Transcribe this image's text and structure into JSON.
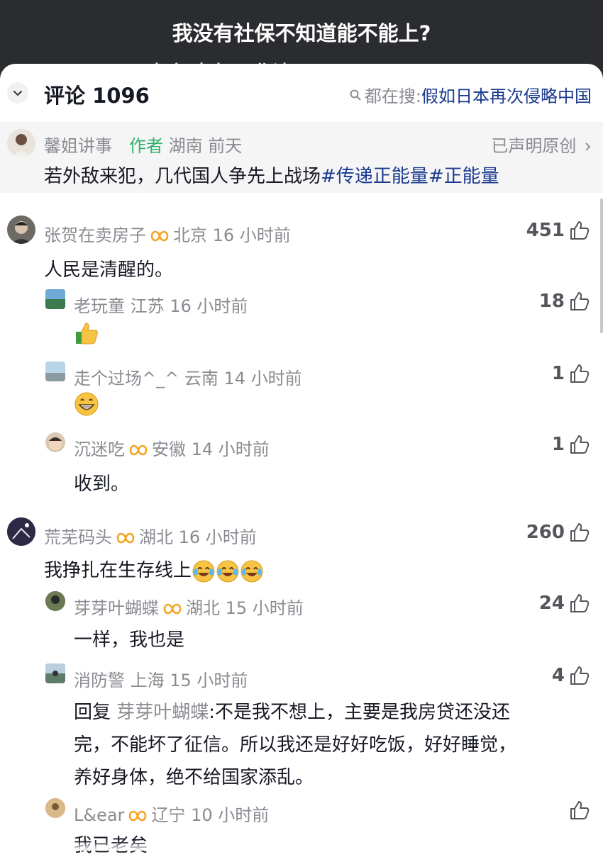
{
  "video": {
    "caption_line1": "我没有社保不知道能不能上?",
    "caption_line2": "有房 大有用              作请?"
  },
  "header": {
    "comment_count": "评论 1096",
    "search_prefix": "都在搜:",
    "search_term": "假如日本再次侵略中国"
  },
  "post": {
    "author": "馨姐讲事",
    "author_tag": "作者",
    "location": "湖南",
    "time": "前天",
    "declared": "已声明原创",
    "text": "若外敌来犯，几代国人争先上战场",
    "hashtag1": "#传递正能量",
    "hashtag2": "#正能量"
  },
  "comments": [
    {
      "name": "张贺在卖房子",
      "meta": "北京 16 小时前",
      "likes": "451",
      "text": "人民是清醒的。"
    },
    {
      "name": "老玩童",
      "meta": "江苏 16 小时前",
      "likes": "18",
      "text": ""
    },
    {
      "name": "走个过场^_^",
      "meta": "云南 14 小时前",
      "likes": "1",
      "text": ""
    },
    {
      "name": "沉迷吃",
      "meta": "安徽 14 小时前",
      "likes": "1",
      "text": "收到。"
    },
    {
      "name": "荒芜码头",
      "meta": "湖北 16 小时前",
      "likes": "260",
      "text": "我挣扎在生存线上"
    },
    {
      "name": "芽芽叶蝴蝶",
      "meta": "湖北 15 小时前",
      "likes": "24",
      "text": "一样，我也是"
    },
    {
      "name": "消防警",
      "meta": "上海 15 小时前",
      "likes": "4",
      "reply_prefix": "回复",
      "reply_to": "芽芽叶蝴蝶",
      "line1": ":不是我不想上，主要是我房贷还没还",
      "line2": "完，不能坏了征信。所以我还是好好吃饭，好好睡觉，",
      "line3": "养好身体，绝不给国家添乱。"
    },
    {
      "name": "L&ear",
      "meta": "辽宁 10 小时前",
      "likes": "",
      "text": "我已老矣"
    }
  ],
  "icons": {
    "like": "thumbs-up-outline-icon",
    "badge": "infinity-badge-icon",
    "collapse": "chevron-down-icon",
    "search": "search-icon"
  },
  "colors": {
    "hashtag": "#1a3a8f",
    "author_tag": "#2ab368",
    "badge": "#f5a623",
    "meta": "#8a8b91"
  }
}
